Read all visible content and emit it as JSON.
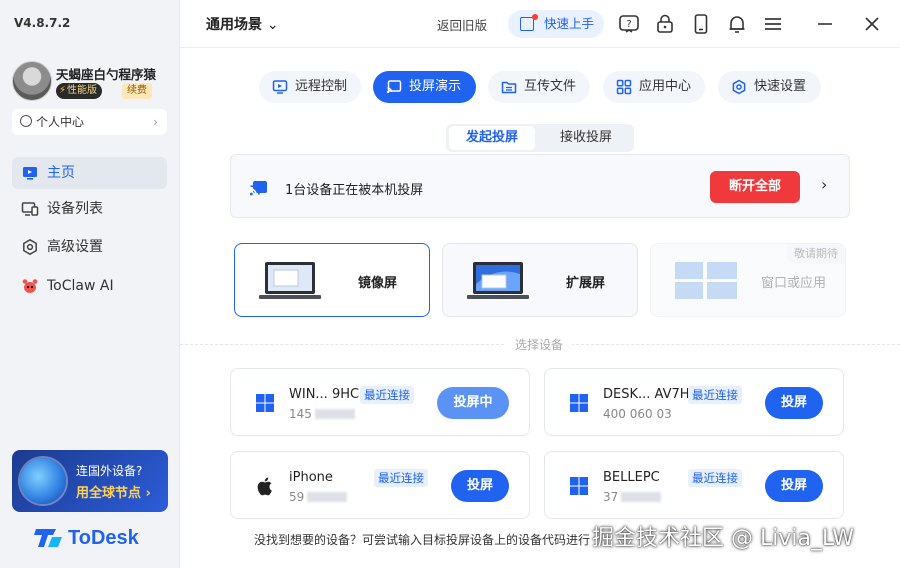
{
  "app": {
    "version": "V4.8.7.2",
    "brand": "ToDesk",
    "accent": "#1f63f0"
  },
  "profile": {
    "username": "天蝎座白勺程序猿",
    "badge": "性能版",
    "renew": "续费",
    "personal_center": "个人中心"
  },
  "sidebar": {
    "items": [
      {
        "label": "主页",
        "icon": "home-icon",
        "active": true
      },
      {
        "label": "设备列表",
        "icon": "device-list-icon",
        "active": false
      },
      {
        "label": "高级设置",
        "icon": "gear-icon",
        "active": false
      },
      {
        "label": "ToClaw AI",
        "icon": "claw-icon",
        "active": false
      }
    ],
    "promo": {
      "title": "连国外设备?",
      "cta": "用全球节点"
    }
  },
  "topbar": {
    "scene": "通用场景",
    "old_version": "返回旧版",
    "quick_start": "快速上手",
    "icons": [
      "help-icon",
      "lock-icon",
      "phone-icon",
      "bell-icon",
      "menu-icon",
      "minimize-icon",
      "close-icon"
    ]
  },
  "main_tabs": [
    {
      "label": "远程控制",
      "active": false
    },
    {
      "label": "投屏演示",
      "active": true
    },
    {
      "label": "互传文件",
      "active": false
    },
    {
      "label": "应用中心",
      "active": false
    },
    {
      "label": "快速设置",
      "active": false
    }
  ],
  "sub_tabs": [
    {
      "label": "发起投屏",
      "active": true
    },
    {
      "label": "接收投屏",
      "active": false
    }
  ],
  "status": {
    "text": "1台设备正在被本机投屏",
    "disconnect_all": "断开全部",
    "danger_color": "#f0393d"
  },
  "modes": [
    {
      "label": "镜像屏",
      "selected": true
    },
    {
      "label": "扩展屏",
      "selected": false
    },
    {
      "label": "窗口或应用",
      "selected": false,
      "soon": "敬请期待"
    }
  ],
  "section_label": "选择设备",
  "devices": [
    {
      "name": "WIN... 9HC",
      "code": "145",
      "recent": "最近连接",
      "action": "投屏中",
      "os": "windows"
    },
    {
      "name": "DESK... AV7H",
      "code": "400 060 03",
      "recent": "最近连接",
      "action": "投屏",
      "os": "windows"
    },
    {
      "name": "iPhone",
      "code": "59",
      "recent": "最近连接",
      "action": "投屏",
      "os": "apple"
    },
    {
      "name": "BELLEPC",
      "code": "37",
      "recent": "最近连接",
      "action": "投屏",
      "os": "windows"
    }
  ],
  "footer_hint": "没找到想要的设备？可尝试输入目标投屏设备上的设备代码进行",
  "watermark": "掘金技术社区 @ Livia_LW"
}
